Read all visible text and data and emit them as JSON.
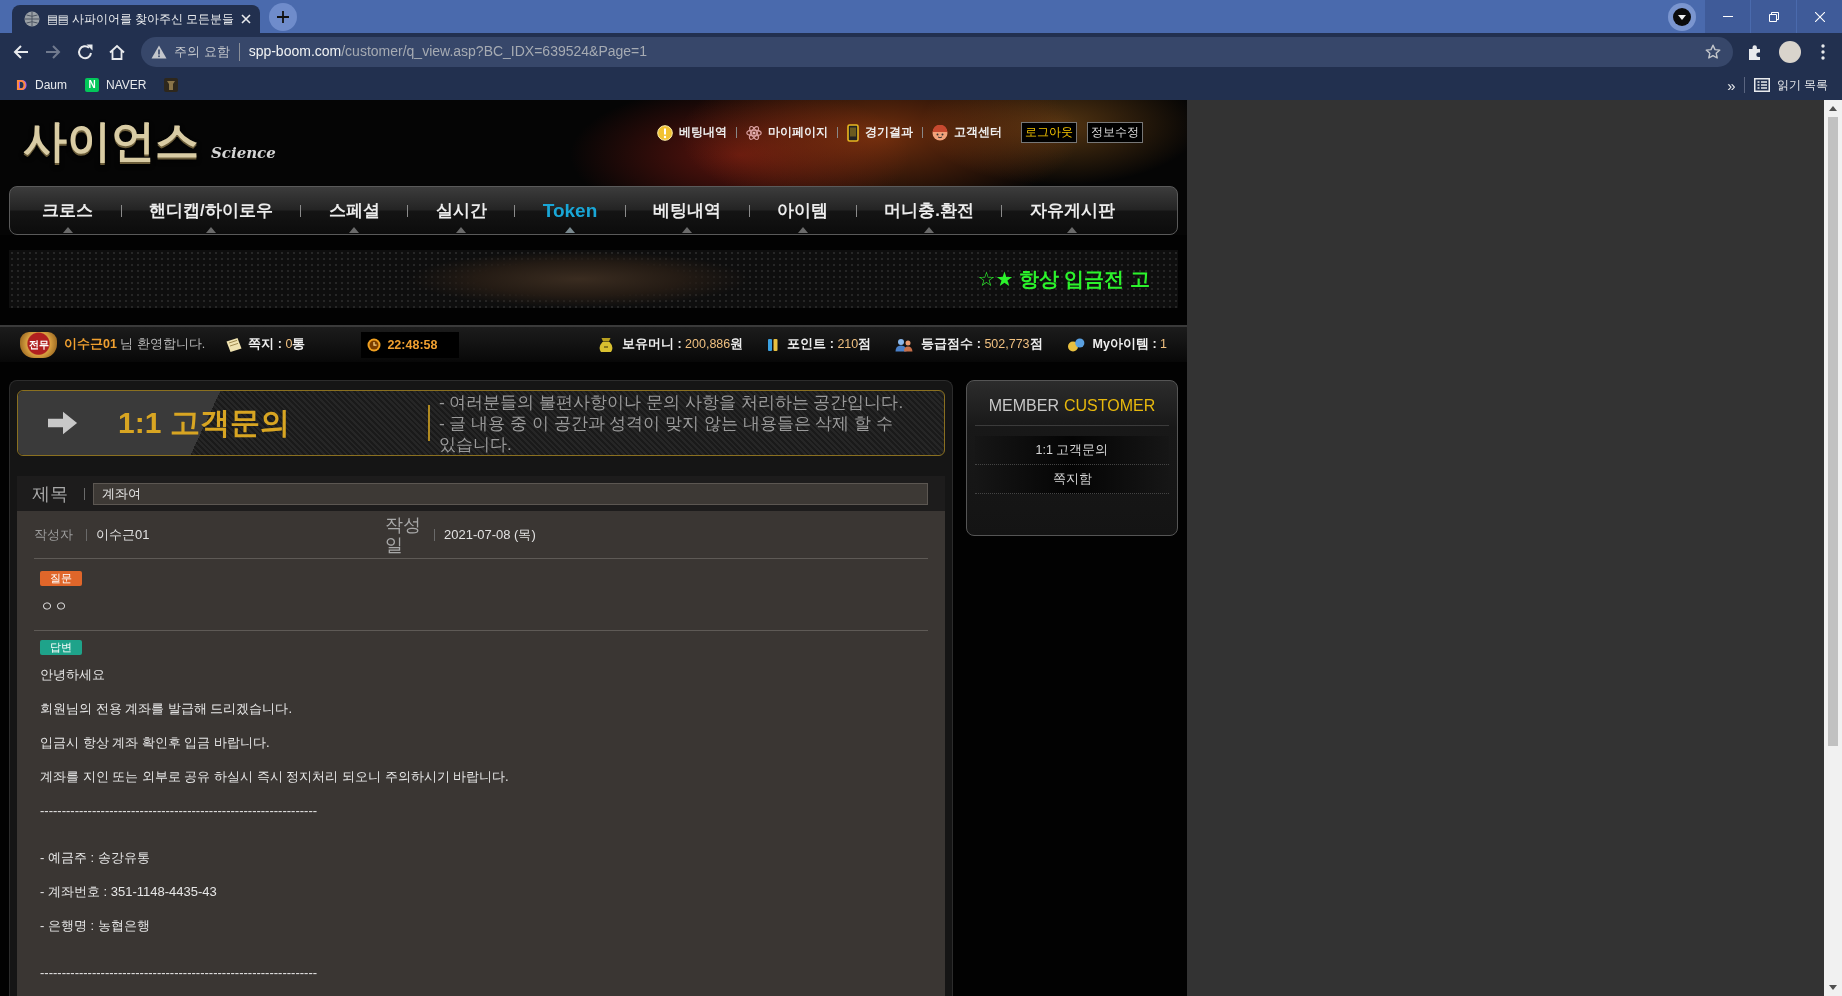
{
  "browser": {
    "tab_title": "▤▤ 사파이어를 찾아주신 모든분들",
    "nav_buttons": [
      {
        "kind": "back",
        "disabled": false
      },
      {
        "kind": "forward",
        "disabled": true
      },
      {
        "kind": "reload",
        "disabled": false
      },
      {
        "kind": "home",
        "disabled": false
      }
    ],
    "security_label": "주의 요함",
    "url_host": "spp-boom.com",
    "url_path": "/customer/q_view.asp?BC_IDX=639524&Page=1",
    "bookmarks": [
      {
        "kind": "letter",
        "icon_text": "D",
        "label": "Daum"
      },
      {
        "kind": "square",
        "icon_text": "N",
        "label": "NAVER"
      },
      {
        "kind": "image"
      }
    ],
    "bookmarks_overflow": "»",
    "reading_list": "읽기 목록"
  },
  "site": {
    "logo": {
      "title": "사이언스",
      "subtitle": "Science"
    },
    "top_links": [
      {
        "kind": "bet",
        "label": "베팅내역"
      },
      {
        "kind": "mypage",
        "label": "마이페이지"
      },
      {
        "kind": "results",
        "label": "경기결과"
      },
      {
        "kind": "support",
        "label": "고객센터"
      }
    ],
    "account_buttons": [
      {
        "kind": "logout",
        "label": "로그아웃"
      },
      {
        "kind": "edit",
        "label": "정보수정"
      }
    ],
    "nav": [
      {
        "label": "크로스",
        "selected": false
      },
      {
        "label": "핸디캡/하이로우",
        "selected": false
      },
      {
        "label": "스페셜",
        "selected": false
      },
      {
        "label": "실시간",
        "selected": false
      },
      {
        "label": "Token",
        "selected": true
      },
      {
        "label": "베팅내역",
        "selected": false
      },
      {
        "label": "아이템",
        "selected": false
      },
      {
        "label": "머니충.환전",
        "selected": false
      },
      {
        "label": "자유게시판",
        "selected": false
      }
    ],
    "banner_text": "☆★ 항상 입금전 고",
    "user_bar": {
      "rank_badge": "전무",
      "username": "이수근01",
      "greeting": "님 환영합니다.",
      "messages": {
        "label": "쪽지 :",
        "value": "0",
        "unit": "통"
      },
      "clock": "22:48:58",
      "stats": [
        {
          "kind": "money",
          "label": "보유머니 :",
          "value": "200,886",
          "unit": "원"
        },
        {
          "kind": "point",
          "label": "포인트 :",
          "value": "210",
          "unit": "점"
        },
        {
          "kind": "grade",
          "label": "등급점수 :",
          "value": "502,773",
          "unit": "점"
        },
        {
          "kind": "item",
          "label": "My아이템 :",
          "value": "1"
        }
      ]
    }
  },
  "page": {
    "title": "1:1 고객문의",
    "description": [
      "- 여러분들의 불편사항이나 문의 사항을 처리하는 공간입니다.",
      "- 글 내용 중 이 공간과 성격이 맞지 않는 내용들은 삭제 할 수 있습니다."
    ],
    "subject": {
      "label": "제목",
      "value": "계좌여"
    },
    "meta": [
      {
        "kind": "author",
        "label": "작성자",
        "value": "이수근01"
      },
      {
        "kind": "date",
        "label": "작성일",
        "value": "2021-07-08 (목)"
      }
    ],
    "question": {
      "badge": "질문",
      "text": "ㅇㅇ"
    },
    "answer": {
      "badge": "답변",
      "sections": [
        [
          "안녕하세요",
          "회원님의 전용 계좌를 발급해 드리겠습니다.",
          "입금시 항상 계좌 확인후 입금 바랍니다.",
          "계좌를 지인 또는 외부로 공유 하실시 즉시 정지처리 되오니 주의하시기 바랍니다.",
          "----------------------------------------------------------------"
        ],
        [
          "- 예금주 : 송강유통",
          "- 계좌번호 : 351-1148-4435-43",
          "- 은행명 : 농협은행"
        ],
        [
          "----------------------------------------------------------------"
        ]
      ]
    }
  },
  "sidebar": {
    "title_main": "MEMBER",
    "title_accent": "CUSTOMER",
    "items": [
      {
        "label": "1:1 고객문의"
      },
      {
        "label": "쪽지함"
      }
    ]
  }
}
